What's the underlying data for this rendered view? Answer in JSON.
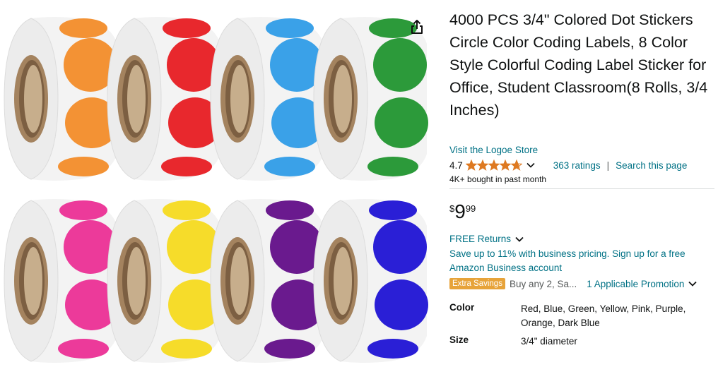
{
  "product": {
    "title": "4000 PCS 3/4\" Colored Dot Stickers Circle Color Coding Labels, 8 Color Style Colorful Coding Label Sticker for Office, Student Classroom(8 Rolls, 3/4 Inches)",
    "store_link": "Visit the Logoe Store",
    "rating_value": "4.7",
    "stars_out_of_5": 4.7,
    "ratings_count": "363 ratings",
    "separator": "|",
    "search_page_link": "Search this page",
    "bought": "4K+ bought in past month"
  },
  "price": {
    "symbol": "$",
    "whole": "9",
    "fraction": "99"
  },
  "returns": {
    "label": "FREE Returns"
  },
  "business": {
    "text": "Save up to 11% with business pricing. Sign up for a free Amazon Business account"
  },
  "promotion": {
    "badge": "Extra Savings",
    "buy_any": "Buy any 2, Sa...",
    "applicable": "1 Applicable Promotion"
  },
  "specs": [
    {
      "key": "Color",
      "value": "Red, Blue, Green, Yellow, Pink, Purple, Orange, Dark Blue"
    },
    {
      "key": "Size",
      "value": "3/4\" diameter"
    }
  ],
  "image": {
    "rolls": [
      {
        "color": "#f39234"
      },
      {
        "color": "#e8282d"
      },
      {
        "color": "#3aa1e8"
      },
      {
        "color": "#2c9a3a"
      },
      {
        "color": "#ec3a9a"
      },
      {
        "color": "#f6dc2a"
      },
      {
        "color": "#6a1a8e"
      },
      {
        "color": "#2a1fd6"
      }
    ],
    "share_icon": "share-icon"
  },
  "colors": {
    "link": "#007185",
    "star": "#de7921",
    "badge": "#e7a33a",
    "text": "#0f1111"
  }
}
